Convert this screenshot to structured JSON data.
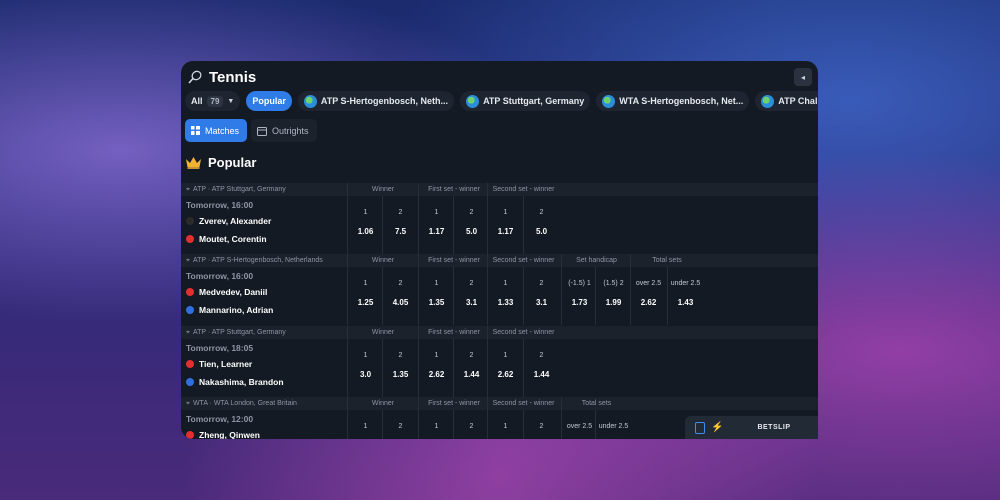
{
  "app": {
    "title": "Tennis",
    "collapse_icon": "◂"
  },
  "filters": {
    "all_label": "All",
    "all_count": "79",
    "chips": [
      "Popular",
      "ATP S-Hertogenbosch, Neth...",
      "ATP Stuttgart, Germany",
      "WTA S-Hertogenbosch, Net...",
      "ATP Challenger Br"
    ]
  },
  "tabs": [
    {
      "label": "Matches"
    },
    {
      "label": "Outrights"
    }
  ],
  "section": {
    "title": "Popular"
  },
  "matches": [
    {
      "league": "ATP · ATP Stuttgart, Germany",
      "time": "Tomorrow, 16:00",
      "team1": "Zverev, Alexander",
      "team2": "Moutet, Corentin",
      "groups": [
        "Winner",
        "First set - winner",
        "Second set - winner"
      ],
      "odds": [
        {
          "label": "1",
          "value": "1.06"
        },
        {
          "label": "2",
          "value": "7.5"
        },
        {
          "label": "1",
          "value": "1.17"
        },
        {
          "label": "2",
          "value": "5.0"
        },
        {
          "label": "1",
          "value": "1.17"
        },
        {
          "label": "2",
          "value": "5.0"
        }
      ]
    },
    {
      "league": "ATP · ATP S-Hertogenbosch, Netherlands",
      "time": "Tomorrow, 16:00",
      "team1": "Medvedev, Daniil",
      "team2": "Mannarino, Adrian",
      "groups": [
        "Winner",
        "First set - winner",
        "Second set - winner",
        "Set handicap",
        "Total sets"
      ],
      "odds": [
        {
          "label": "1",
          "value": "1.25"
        },
        {
          "label": "2",
          "value": "4.05"
        },
        {
          "label": "1",
          "value": "1.35"
        },
        {
          "label": "2",
          "value": "3.1"
        },
        {
          "label": "1",
          "value": "1.33"
        },
        {
          "label": "2",
          "value": "3.1"
        },
        {
          "label": "(-1.5) 1",
          "value": "1.73"
        },
        {
          "label": "(1.5) 2",
          "value": "1.99"
        },
        {
          "label": "over 2.5",
          "value": "2.62"
        },
        {
          "label": "under 2.5",
          "value": "1.43"
        }
      ]
    },
    {
      "league": "ATP · ATP Stuttgart, Germany",
      "time": "Tomorrow, 18:05",
      "team1": "Tien, Learner",
      "team2": "Nakashima, Brandon",
      "groups": [
        "Winner",
        "First set - winner",
        "Second set - winner"
      ],
      "odds": [
        {
          "label": "1",
          "value": "3.0"
        },
        {
          "label": "2",
          "value": "1.35"
        },
        {
          "label": "1",
          "value": "2.62"
        },
        {
          "label": "2",
          "value": "1.44"
        },
        {
          "label": "1",
          "value": "2.62"
        },
        {
          "label": "2",
          "value": "1.44"
        }
      ]
    },
    {
      "league": "WTA · WTA London, Great Britain",
      "time": "Tomorrow, 12:00",
      "team1": "Zheng, Qinwen",
      "team2": "",
      "groups": [
        "Winner",
        "First set - winner",
        "Second set - winner",
        "Total sets"
      ],
      "odds": [
        {
          "label": "1",
          "value": ""
        },
        {
          "label": "2",
          "value": ""
        },
        {
          "label": "1",
          "value": ""
        },
        {
          "label": "2",
          "value": ""
        },
        {
          "label": "1",
          "value": ""
        },
        {
          "label": "2",
          "value": ""
        },
        {
          "label": "over 2.5",
          "value": ""
        },
        {
          "label": "under 2.5",
          "value": ""
        }
      ]
    }
  ],
  "betslip": {
    "label": "BETSLIP"
  }
}
